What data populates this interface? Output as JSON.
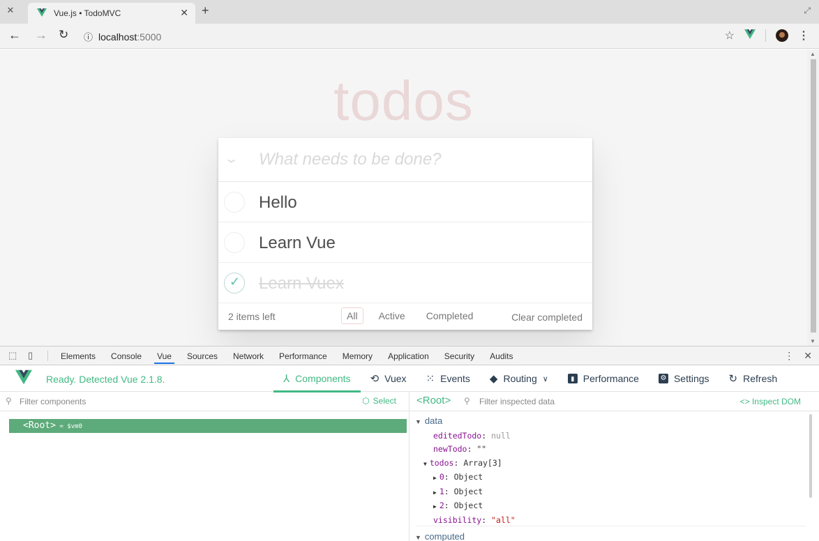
{
  "browser": {
    "tab_title": "Vue.js • TodoMVC",
    "url_host": "localhost",
    "url_port": ":5000"
  },
  "page": {
    "heading": "todos",
    "new_todo_placeholder": "What needs to be done?",
    "todos": [
      {
        "title": "Hello",
        "completed": false
      },
      {
        "title": "Learn Vue",
        "completed": false
      },
      {
        "title": "Learn Vuex",
        "completed": true
      }
    ],
    "items_left": "2 items left",
    "filters": [
      "All",
      "Active",
      "Completed"
    ],
    "selected_filter": "All",
    "clear_completed": "Clear completed"
  },
  "devtools": {
    "tabs": [
      "Elements",
      "Console",
      "Vue",
      "Sources",
      "Network",
      "Performance",
      "Memory",
      "Application",
      "Security",
      "Audits"
    ],
    "active_tab": "Vue",
    "vue": {
      "status": "Ready. Detected Vue 2.1.8.",
      "tabs": {
        "components": "Components",
        "vuex": "Vuex",
        "events": "Events",
        "routing": "Routing",
        "performance": "Performance",
        "settings": "Settings",
        "refresh": "Refresh"
      },
      "filter_components_placeholder": "Filter components",
      "select_label": "Select",
      "root_label": "<Root>",
      "root_vm": " = $vm0",
      "selected_component": "<Root>",
      "filter_data_placeholder": "Filter inspected data",
      "inspect_dom": "Inspect DOM",
      "data_section": "data",
      "computed_section": "computed",
      "data": {
        "editedTodo_key": "editedTodo",
        "editedTodo_val": "null",
        "newTodo_key": "newTodo",
        "newTodo_val": "\"\"",
        "todos_key": "todos",
        "todos_val": "Array[3]",
        "item0_key": "0",
        "item1_key": "1",
        "item2_key": "2",
        "item_val": "Object",
        "visibility_key": "visibility",
        "visibility_val": "\"all\""
      }
    }
  },
  "colors": {
    "vue_green": "#42b983",
    "selected_row": "#5daa7a",
    "todo_heading": "rgba(175,47,47,0.15)"
  }
}
